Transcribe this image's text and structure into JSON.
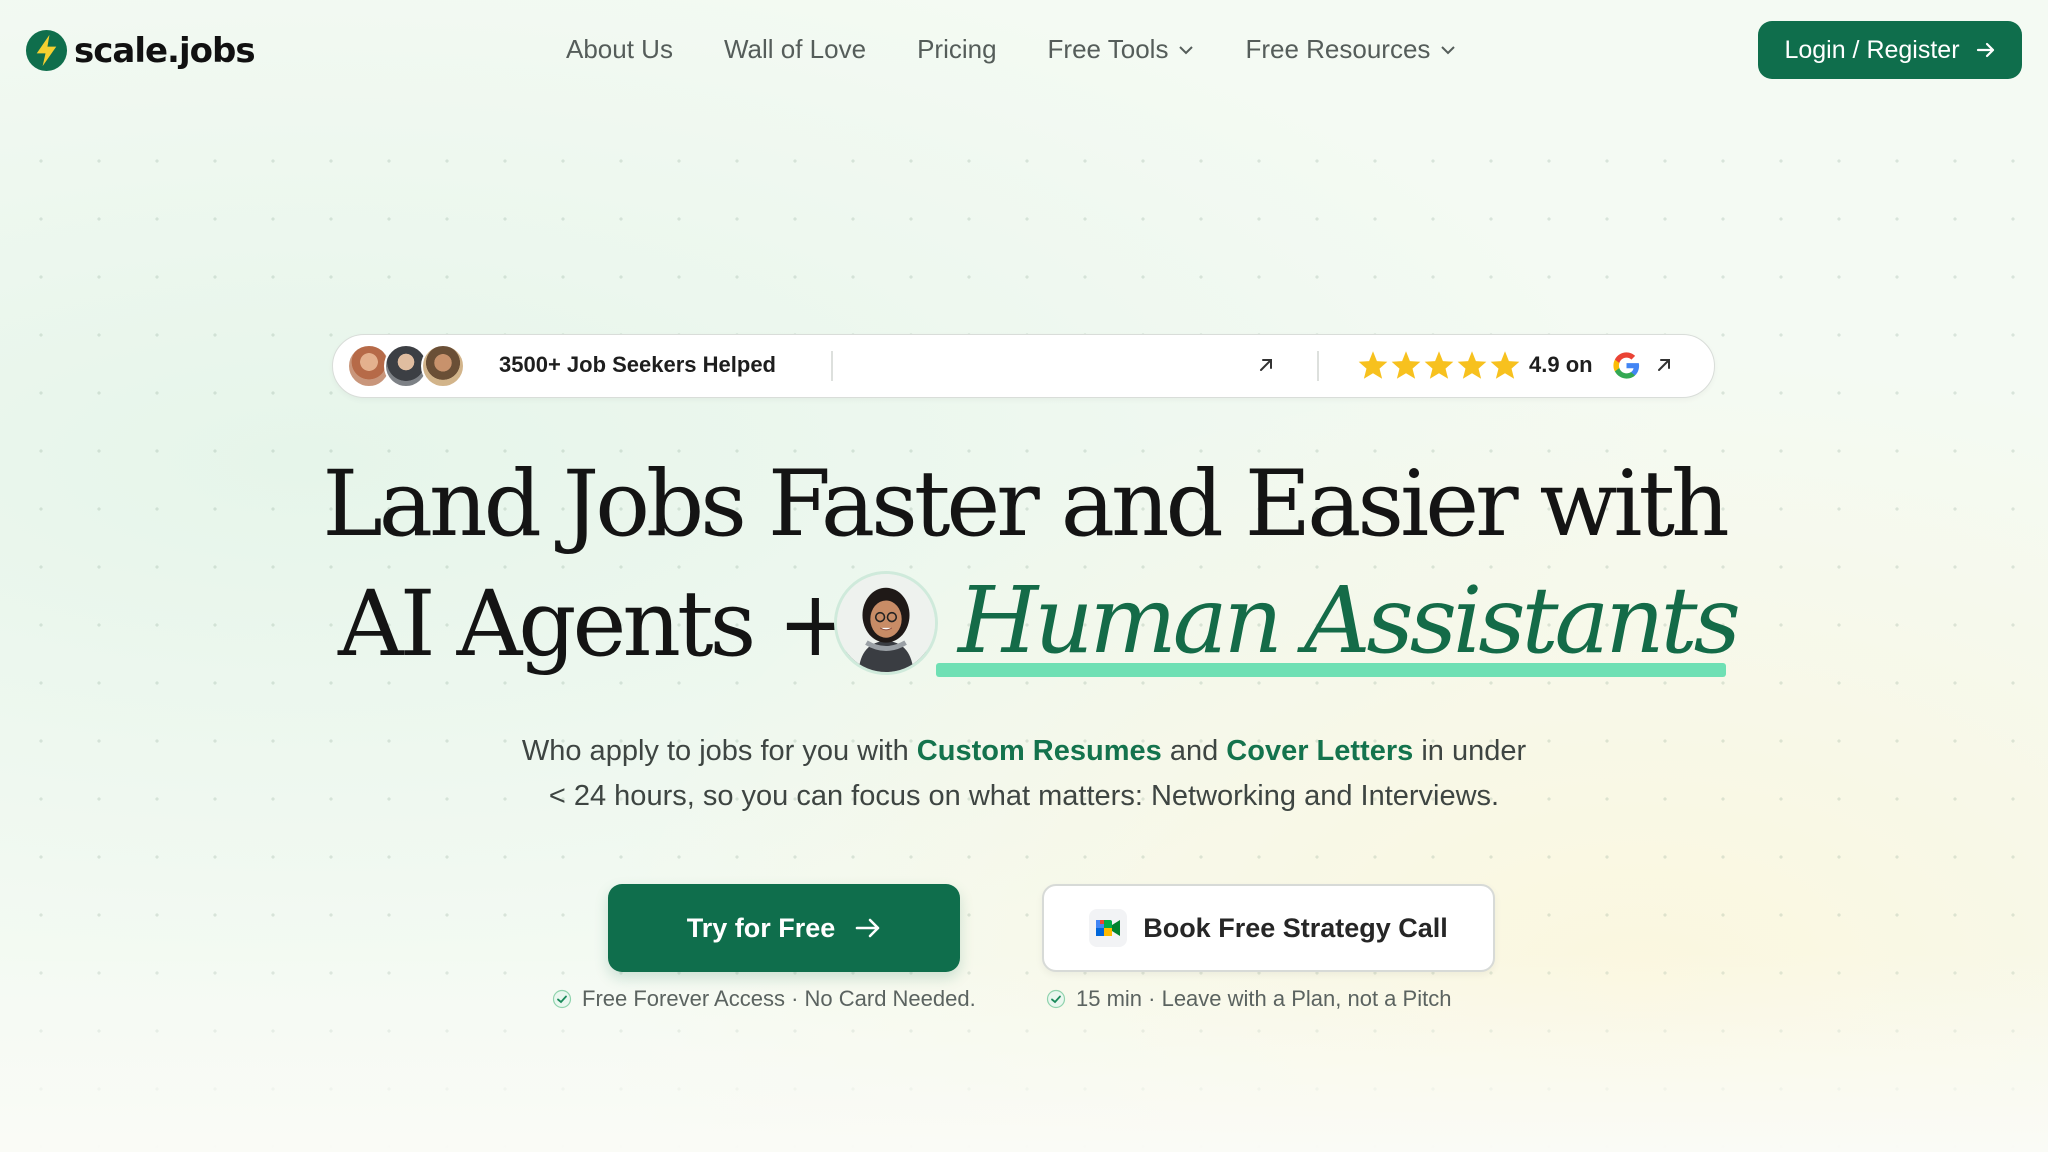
{
  "brand": {
    "name": "scale.jobs",
    "accent": "#0f6e4c",
    "highlight": "#6fe0b4"
  },
  "nav": {
    "items": [
      {
        "label": "About Us",
        "dropdown": false
      },
      {
        "label": "Wall of Love",
        "dropdown": false
      },
      {
        "label": "Pricing",
        "dropdown": false
      },
      {
        "label": "Free Tools",
        "dropdown": true
      },
      {
        "label": "Free Resources",
        "dropdown": true
      }
    ],
    "login_label": "Login / Register"
  },
  "social_proof": {
    "helped_text": "3500+ Job Seekers Helped",
    "stars": 5,
    "rating_text": "4.9 on",
    "rating_source_icon": "google-icon"
  },
  "hero": {
    "line1": "Land Jobs Faster and Easier with",
    "line2_prefix": "AI Agents +",
    "line2_highlight": "Human Assistants",
    "sub_part1": "Who apply to jobs for you with",
    "sub_bold1": "Custom Resumes",
    "sub_part2": "and",
    "sub_bold2": "Cover Letters",
    "sub_part3": "in under",
    "sub_line2": "< 24 hours, so you can focus on what matters: Networking and Interviews."
  },
  "cta": {
    "primary_label": "Try for Free",
    "primary_note": "Free Forever Access · No Card Needed.",
    "secondary_label": "Book Free Strategy Call",
    "secondary_icon": "google-meet-icon",
    "secondary_note": "15 min · Leave with a Plan, not a Pitch"
  }
}
